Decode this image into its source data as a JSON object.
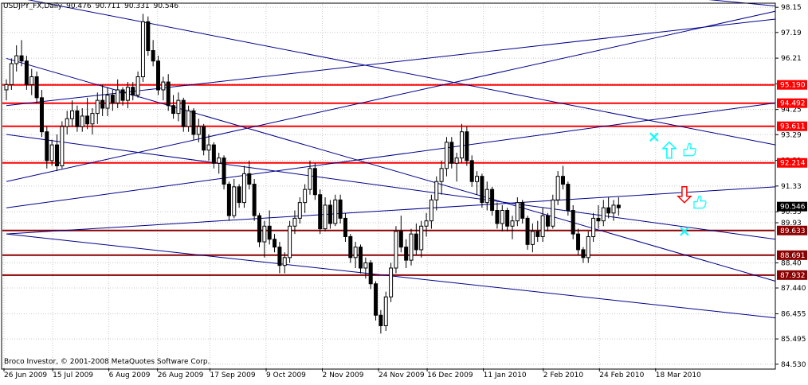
{
  "chart_data": {
    "type": "candlestick",
    "symbol_label": "USDJPY_FX,Daily",
    "ohlc_text": [
      "90.476",
      "90.711",
      "90.331",
      "90.546"
    ],
    "copyright": "Broco Investor, © 2001-2008 MetaQuotes Software Corp.",
    "grid": true,
    "colors": {
      "background": "#ffffff",
      "candle": "#000000",
      "grid": "#c8c8c8",
      "channel_lines": "#00008b",
      "bright_red_level": "#ff0000",
      "dark_red_level": "#8b0000",
      "current_price_label": "#ffffff",
      "signal_up": "#00ffff",
      "signal_down": "#ff0000"
    },
    "y_axis": {
      "ylim": [
        84.375,
        98.277
      ],
      "ticks": [
        "98.15",
        "97.19",
        "96.21",
        "95.23",
        "94.25",
        "93.29",
        "92.31",
        "91.33",
        "90.35",
        "89.93",
        "88.40",
        "87.440",
        "86.455",
        "85.495",
        "84.530"
      ]
    },
    "x_axis": {
      "labels": [
        "26 Jun 2009",
        "15 Jul 2009",
        "6 Aug 2009",
        "26 Aug 2009",
        "17 Sep 2009",
        "9 Oct 2009",
        "2 Nov 2009",
        "24 Nov 2009",
        "16 Dec 2009",
        "11 Jan 2010",
        "2 Feb 2010",
        "24 Feb 2010",
        "18 Mar 2010"
      ]
    },
    "levels": [
      {
        "value": "95.190",
        "style": "bright"
      },
      {
        "value": "94.492",
        "style": "bright"
      },
      {
        "value": "93.611",
        "style": "bright"
      },
      {
        "value": "92.214",
        "style": "bright"
      },
      {
        "value": "89.633",
        "style": "dark"
      },
      {
        "value": "88.691",
        "style": "dark"
      },
      {
        "value": "87.932",
        "style": "dark"
      }
    ],
    "current_price": "90.546",
    "series": [
      {
        "values": [
          [
            95.0,
            95.4,
            94.6,
            95.2
          ],
          [
            95.2,
            96.2,
            95.0,
            96.0
          ],
          [
            96.0,
            96.7,
            95.7,
            96.3
          ],
          [
            96.3,
            96.9,
            95.9,
            96.1
          ],
          [
            96.1,
            96.3,
            95.0,
            95.2
          ],
          [
            95.2,
            95.8,
            94.8,
            95.5
          ],
          [
            95.5,
            95.7,
            94.5,
            94.7
          ],
          [
            94.7,
            95.0,
            93.2,
            93.4
          ],
          [
            93.4,
            93.6,
            92.0,
            92.3
          ],
          [
            92.3,
            93.1,
            92.1,
            92.9
          ],
          [
            92.9,
            93.3,
            91.9,
            92.1
          ],
          [
            92.1,
            93.8,
            92.0,
            93.6
          ],
          [
            93.6,
            94.2,
            93.3,
            93.9
          ],
          [
            93.9,
            94.6,
            93.6,
            94.2
          ],
          [
            94.2,
            94.4,
            93.4,
            93.6
          ],
          [
            93.6,
            94.3,
            93.4,
            94.0
          ],
          [
            94.0,
            94.7,
            93.5,
            93.7
          ],
          [
            93.7,
            94.3,
            93.3,
            94.1
          ],
          [
            94.1,
            94.9,
            93.7,
            94.6
          ],
          [
            94.6,
            95.2,
            94.0,
            94.3
          ],
          [
            94.3,
            95.1,
            94.0,
            94.8
          ],
          [
            94.8,
            95.0,
            94.2,
            94.5
          ],
          [
            94.5,
            95.4,
            94.3,
            95.0
          ],
          [
            95.0,
            95.1,
            94.4,
            94.6
          ],
          [
            94.6,
            95.3,
            94.3,
            95.1
          ],
          [
            95.1,
            95.3,
            94.6,
            94.8
          ],
          [
            94.8,
            95.7,
            94.7,
            95.5
          ],
          [
            95.5,
            97.9,
            95.3,
            97.6
          ],
          [
            97.6,
            97.8,
            96.3,
            96.5
          ],
          [
            96.5,
            96.9,
            95.9,
            96.1
          ],
          [
            96.1,
            96.3,
            94.8,
            95.0
          ],
          [
            95.0,
            95.5,
            94.6,
            95.3
          ],
          [
            95.3,
            95.6,
            94.2,
            94.4
          ],
          [
            94.4,
            94.8,
            93.9,
            94.1
          ],
          [
            94.1,
            94.9,
            93.8,
            94.6
          ],
          [
            94.6,
            94.7,
            93.4,
            93.6
          ],
          [
            93.6,
            94.4,
            93.4,
            94.2
          ],
          [
            94.2,
            94.3,
            93.1,
            93.3
          ],
          [
            93.3,
            93.9,
            93.0,
            93.6
          ],
          [
            93.6,
            93.7,
            92.5,
            92.7
          ],
          [
            92.7,
            93.3,
            92.3,
            92.9
          ],
          [
            92.9,
            93.0,
            92.0,
            92.2
          ],
          [
            92.2,
            92.6,
            91.8,
            92.4
          ],
          [
            92.4,
            92.5,
            91.2,
            91.4
          ],
          [
            91.4,
            91.5,
            90.0,
            90.2
          ],
          [
            90.2,
            91.6,
            90.1,
            91.3
          ],
          [
            91.3,
            91.4,
            90.5,
            90.7
          ],
          [
            90.7,
            92.1,
            90.5,
            91.8
          ],
          [
            91.8,
            92.3,
            91.2,
            91.4
          ],
          [
            91.4,
            91.6,
            90.0,
            90.2
          ],
          [
            90.2,
            90.3,
            89.0,
            89.2
          ],
          [
            89.2,
            90.0,
            88.6,
            89.8
          ],
          [
            89.8,
            90.4,
            89.1,
            89.3
          ],
          [
            89.3,
            89.5,
            88.8,
            89.0
          ],
          [
            89.0,
            89.2,
            88.0,
            88.3
          ],
          [
            88.3,
            88.8,
            88.0,
            88.6
          ],
          [
            88.6,
            90.0,
            88.4,
            89.8
          ],
          [
            89.8,
            90.4,
            89.5,
            90.1
          ],
          [
            90.1,
            90.9,
            89.9,
            90.7
          ],
          [
            90.7,
            91.4,
            90.3,
            91.2
          ],
          [
            91.2,
            92.3,
            91.0,
            92.0
          ],
          [
            92.0,
            92.2,
            90.8,
            91.0
          ],
          [
            91.0,
            91.2,
            89.5,
            89.7
          ],
          [
            89.7,
            90.9,
            89.6,
            90.6
          ],
          [
            90.6,
            90.8,
            89.7,
            89.9
          ],
          [
            89.9,
            91.0,
            89.8,
            90.8
          ],
          [
            90.8,
            91.0,
            89.9,
            90.1
          ],
          [
            90.1,
            90.3,
            89.2,
            89.4
          ],
          [
            89.4,
            89.5,
            88.4,
            88.6
          ],
          [
            88.6,
            89.2,
            88.2,
            89.0
          ],
          [
            89.0,
            89.1,
            88.0,
            88.2
          ],
          [
            88.2,
            88.6,
            87.8,
            88.4
          ],
          [
            88.4,
            88.5,
            87.4,
            87.6
          ],
          [
            87.6,
            87.7,
            86.2,
            86.4
          ],
          [
            86.4,
            86.6,
            85.7,
            86.0
          ],
          [
            86.0,
            87.3,
            85.8,
            87.1
          ],
          [
            87.1,
            88.4,
            86.9,
            88.2
          ],
          [
            88.2,
            89.8,
            88.0,
            89.6
          ],
          [
            89.6,
            90.2,
            88.8,
            89.0
          ],
          [
            89.0,
            89.3,
            88.2,
            88.5
          ],
          [
            88.5,
            89.7,
            88.3,
            89.5
          ],
          [
            89.5,
            89.9,
            88.7,
            88.9
          ],
          [
            88.9,
            90.0,
            88.6,
            89.8
          ],
          [
            89.8,
            90.3,
            89.4,
            90.0
          ],
          [
            90.0,
            91.0,
            89.7,
            90.8
          ],
          [
            90.8,
            91.7,
            90.4,
            91.5
          ],
          [
            91.5,
            92.3,
            91.0,
            92.0
          ],
          [
            92.0,
            93.2,
            91.7,
            93.0
          ],
          [
            93.0,
            93.2,
            92.0,
            92.2
          ],
          [
            92.2,
            92.6,
            91.5,
            92.4
          ],
          [
            92.4,
            93.7,
            92.2,
            93.4
          ],
          [
            93.4,
            93.6,
            92.1,
            92.3
          ],
          [
            92.3,
            92.5,
            91.3,
            91.5
          ],
          [
            91.5,
            91.9,
            91.0,
            91.7
          ],
          [
            91.7,
            91.8,
            90.5,
            90.7
          ],
          [
            90.7,
            91.5,
            90.4,
            91.2
          ],
          [
            91.2,
            91.3,
            90.2,
            90.4
          ],
          [
            90.4,
            90.7,
            89.7,
            89.9
          ],
          [
            89.9,
            90.6,
            89.6,
            90.4
          ],
          [
            90.4,
            90.5,
            89.6,
            89.8
          ],
          [
            89.8,
            90.2,
            89.3,
            90.0
          ],
          [
            90.0,
            90.9,
            89.8,
            90.7
          ],
          [
            90.7,
            90.8,
            89.9,
            90.1
          ],
          [
            90.1,
            90.2,
            88.9,
            89.1
          ],
          [
            89.1,
            89.9,
            88.8,
            89.6
          ],
          [
            89.6,
            90.0,
            89.2,
            89.4
          ],
          [
            89.4,
            90.5,
            89.2,
            90.2
          ],
          [
            90.2,
            90.3,
            89.6,
            89.8
          ],
          [
            89.8,
            91.0,
            89.7,
            90.8
          ],
          [
            90.8,
            91.9,
            90.6,
            91.7
          ],
          [
            91.7,
            92.1,
            91.2,
            91.4
          ],
          [
            91.4,
            91.5,
            90.2,
            90.4
          ],
          [
            90.4,
            90.6,
            89.3,
            89.5
          ],
          [
            89.5,
            89.7,
            88.7,
            88.9
          ],
          [
            88.9,
            89.0,
            88.4,
            88.6
          ],
          [
            88.6,
            89.6,
            88.4,
            89.4
          ],
          [
            89.4,
            90.3,
            89.2,
            90.1
          ],
          [
            90.1,
            90.6,
            89.7,
            90.0
          ],
          [
            90.0,
            90.8,
            89.8,
            90.5
          ],
          [
            90.5,
            90.9,
            90.1,
            90.3
          ],
          [
            90.3,
            90.8,
            90.0,
            90.6
          ],
          [
            90.6,
            90.9,
            90.2,
            90.5
          ]
        ]
      }
    ],
    "trend_lines": [
      {
        "from": [
          0,
          94.4
        ],
        "to": [
          152,
          97.7
        ]
      },
      {
        "from": [
          0,
          89.5
        ],
        "to": [
          152,
          91.3
        ]
      },
      {
        "from": [
          0,
          89.5
        ],
        "to": [
          152,
          86.3
        ]
      },
      {
        "from": [
          0,
          93.3
        ],
        "to": [
          152,
          89.3
        ]
      },
      {
        "from": [
          0,
          96.2
        ],
        "to": [
          152,
          87.7
        ]
      },
      {
        "from": [
          0,
          98.6
        ],
        "to": [
          152,
          92.9
        ]
      },
      {
        "from": [
          0,
          101.0
        ],
        "to": [
          152,
          98.2
        ]
      },
      {
        "from": [
          0,
          90.5
        ],
        "to": [
          152,
          94.5
        ]
      },
      {
        "from": [
          0,
          91.5
        ],
        "to": [
          152,
          98.0
        ]
      }
    ],
    "signal_marks": [
      {
        "type": "cross",
        "at": [
          128,
          93.2
        ],
        "color": "signal_up"
      },
      {
        "type": "arrow-up",
        "at": [
          131,
          92.7
        ],
        "color": "signal_up"
      },
      {
        "type": "thumb",
        "at": [
          135,
          92.7
        ],
        "color": "signal_up"
      },
      {
        "type": "arrow-down",
        "at": [
          134,
          91.0
        ],
        "color": "signal_down"
      },
      {
        "type": "thumb",
        "at": [
          137,
          90.7
        ],
        "color": "signal_up"
      },
      {
        "type": "cross",
        "at": [
          134,
          89.6
        ],
        "color": "signal_up"
      }
    ]
  }
}
